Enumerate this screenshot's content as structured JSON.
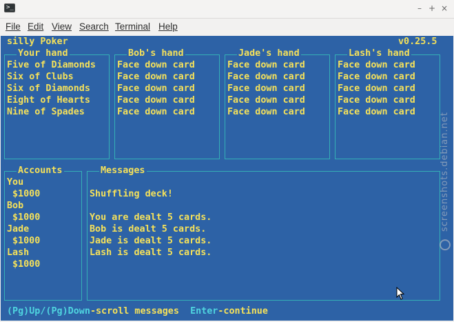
{
  "window": {
    "title": ""
  },
  "menu": [
    "File",
    "Edit",
    "View",
    "Search",
    "Terminal",
    "Help"
  ],
  "app": {
    "name": "silly Poker",
    "version": "v0.25.5"
  },
  "hands": [
    {
      "title": "Your hand",
      "cards": [
        "Five of Diamonds",
        "Six of Clubs",
        "Six of Diamonds",
        "Eight of Hearts",
        "Nine of Spades"
      ]
    },
    {
      "title": "Bob's hand",
      "cards": [
        "Face down card",
        "Face down card",
        "Face down card",
        "Face down card",
        "Face down card"
      ]
    },
    {
      "title": "Jade's hand",
      "cards": [
        "Face down card",
        "Face down card",
        "Face down card",
        "Face down card",
        "Face down card"
      ]
    },
    {
      "title": "Lash's hand",
      "cards": [
        "Face down card",
        "Face down card",
        "Face down card",
        "Face down card",
        "Face down card"
      ]
    }
  ],
  "accounts": {
    "title": "Accounts",
    "players": [
      {
        "name": "You",
        "balance": "$1000"
      },
      {
        "name": "Bob",
        "balance": "$1000"
      },
      {
        "name": "Jade",
        "balance": "$1000"
      },
      {
        "name": "Lash",
        "balance": "$1000"
      }
    ]
  },
  "messages": {
    "title": "Messages",
    "lines": [
      "Shuffling deck!",
      "",
      "You are dealt 5 cards.",
      "Bob is dealt 5 cards.",
      "Jade is dealt 5 cards.",
      "Lash is dealt 5 cards."
    ]
  },
  "footer": {
    "scroll_key": "(Pg)Up/(Pg)Down",
    "scroll_action": "-scroll messages",
    "continue_key": "Enter",
    "continue_action": "-continue"
  },
  "watermark": "screenshots.debian.net",
  "colors": {
    "terminal_bg": "#2d62a6",
    "text": "#f5e15a",
    "border": "#35b1b6",
    "key": "#4fd4df"
  }
}
